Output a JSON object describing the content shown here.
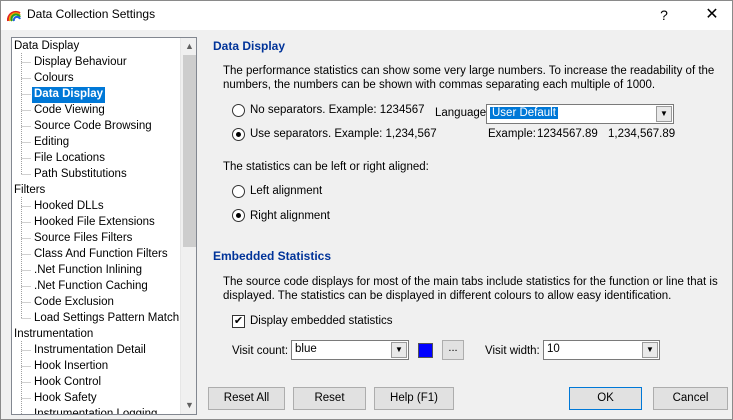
{
  "window": {
    "title": "Data Collection Settings",
    "help_glyph": "?",
    "close_glyph": "✕"
  },
  "tree": {
    "items": [
      {
        "label": "Data Display",
        "level": 0
      },
      {
        "label": "Display Behaviour",
        "level": 1
      },
      {
        "label": "Colours",
        "level": 1
      },
      {
        "label": "Data Display",
        "level": 1,
        "selected": true
      },
      {
        "label": "Code Viewing",
        "level": 1
      },
      {
        "label": "Source Code Browsing",
        "level": 1
      },
      {
        "label": "Editing",
        "level": 1
      },
      {
        "label": "File Locations",
        "level": 1
      },
      {
        "label": "Path Substitutions",
        "level": 1
      },
      {
        "label": "Filters",
        "level": 0
      },
      {
        "label": "Hooked DLLs",
        "level": 1
      },
      {
        "label": "Hooked File Extensions",
        "level": 1
      },
      {
        "label": "Source Files Filters",
        "level": 1
      },
      {
        "label": "Class And Function Filters",
        "level": 1
      },
      {
        "label": ".Net Function Inlining",
        "level": 1
      },
      {
        "label": ".Net Function Caching",
        "level": 1
      },
      {
        "label": "Code Exclusion",
        "level": 1
      },
      {
        "label": "Load Settings Pattern Match",
        "level": 1
      },
      {
        "label": "Instrumentation",
        "level": 0
      },
      {
        "label": "Instrumentation Detail",
        "level": 1
      },
      {
        "label": "Hook Insertion",
        "level": 1
      },
      {
        "label": "Hook Control",
        "level": 1
      },
      {
        "label": "Hook Safety",
        "level": 1
      },
      {
        "label": "Instrumentation Logging",
        "level": 1
      }
    ]
  },
  "data_display": {
    "heading": "Data Display",
    "intro_line1": "The performance statistics can show some very large numbers. To increase the readability of the",
    "intro_line2": "numbers, the numbers can be shown with commas separating each multiple of 1000.",
    "radio_no_sep": "No separators. Example: 1234567",
    "radio_use_sep": "Use separators. Example: 1,234,567",
    "language_label": "Language:",
    "language_value": "User Default",
    "example_label": "Example:",
    "example_plain": "1234567.89",
    "example_sep": "1,234,567.89",
    "align_text": "The statistics can be left or right aligned:",
    "radio_left": "Left alignment",
    "radio_right": "Right alignment"
  },
  "embedded": {
    "heading": "Embedded Statistics",
    "text_line1": "The source code displays for most of the main tabs include statistics for the function or line that is",
    "text_line2": "displayed. The statistics can be displayed in different colours to allow easy identification.",
    "checkbox_label": "Display embedded statistics",
    "checkbox_checked": true,
    "visit_count_label": "Visit count:",
    "visit_count_value": "blue",
    "visit_count_color": "#0000ff",
    "ellipsis_label": "...",
    "visit_width_label": "Visit width:",
    "visit_width_value": "10"
  },
  "buttons": {
    "reset_all": "Reset All",
    "reset": "Reset",
    "help": "Help (F1)",
    "ok": "OK",
    "cancel": "Cancel"
  },
  "colors": {
    "heading": "#003399",
    "selection": "#0078d7"
  }
}
